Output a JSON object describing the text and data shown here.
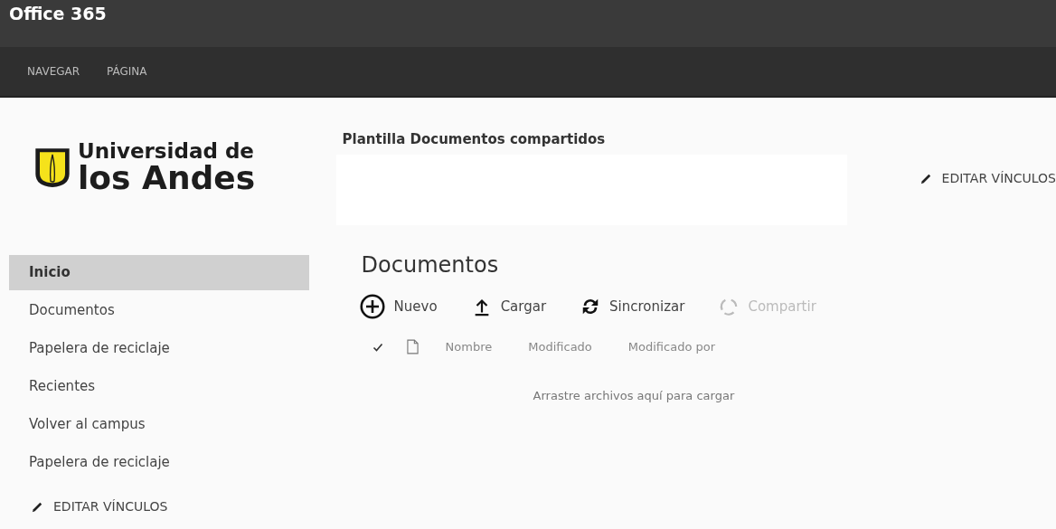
{
  "app_title": "Office 365",
  "ribbon_tabs": [
    {
      "label": "NAVEGAR",
      "selected": false
    },
    {
      "label": "PÁGINA",
      "selected": false
    }
  ],
  "logo": {
    "line_1": "Universidad de",
    "line_2": "los Andes"
  },
  "site_title": "Plantilla Documentos compartidos",
  "top_edit_links": "EDITAR VÍNCULOS",
  "sidebar": {
    "items": [
      {
        "label": "Inicio",
        "selected": true
      },
      {
        "label": "Documentos",
        "selected": false
      },
      {
        "label": "Papelera de reciclaje",
        "selected": false
      },
      {
        "label": "Recientes",
        "selected": false
      },
      {
        "label": "Volver al campus",
        "selected": false
      },
      {
        "label": "Papelera de reciclaje",
        "selected": false
      }
    ],
    "edit_links": "EDITAR VÍNCULOS"
  },
  "library": {
    "title": "Documentos",
    "commands": [
      {
        "kind": "new",
        "label": "Nuevo",
        "disabled": false
      },
      {
        "kind": "upload",
        "label": "Cargar",
        "disabled": false
      },
      {
        "kind": "sync",
        "label": "Sincronizar",
        "disabled": false
      },
      {
        "kind": "share",
        "label": "Compartir",
        "disabled": true
      }
    ],
    "columns": [
      "Nombre",
      "Modificado",
      "Modificado por"
    ],
    "empty_message": "Arrastre archivos aquí para cargar"
  }
}
